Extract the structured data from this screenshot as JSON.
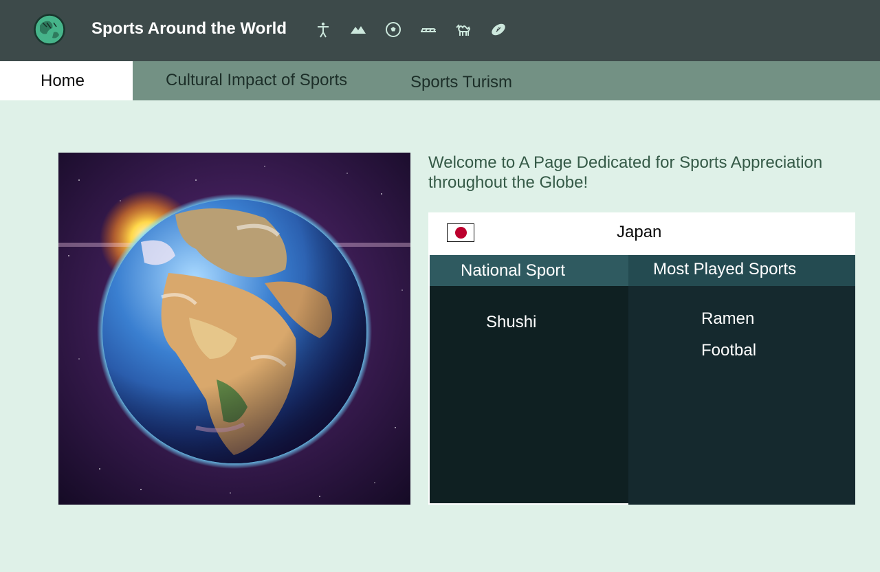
{
  "header": {
    "title": "Sports Around the World",
    "logo_icon": "globe-logo-icon",
    "sport_icons": [
      "gymnastics-icon",
      "mountain-icon",
      "soccer-ball-icon",
      "running-track-icon",
      "camel-icon",
      "football-icon"
    ]
  },
  "nav": {
    "tabs": [
      {
        "label": "Home",
        "active": true
      },
      {
        "label": "Cultural Impact of Sports",
        "active": false
      },
      {
        "label": "Sports Turism",
        "active": false
      }
    ]
  },
  "main": {
    "welcome": "Welcome to A Page Dedicated for Sports Appreciation throughout the Globe!",
    "country": {
      "name": "Japan",
      "flag_icon": "japan-flag-icon",
      "national_sport_header": "National Sport",
      "national_sport": "Shushi",
      "most_played_header": "Most Played Sports",
      "most_played": [
        "Ramen",
        "Footbal"
      ]
    }
  },
  "colors": {
    "header_bg": "#3d4a4a",
    "nav_bg": "#739184",
    "page_bg": "#dff1e8",
    "welcome_text": "#355a47",
    "japan_red": "#bc002d"
  }
}
